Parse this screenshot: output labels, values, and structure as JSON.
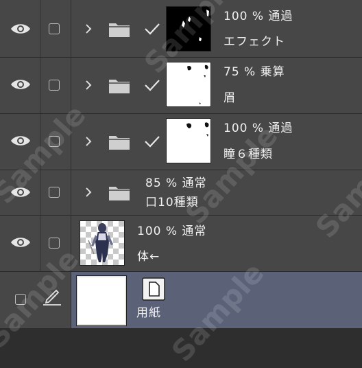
{
  "layers": [
    {
      "opacity": "100 %",
      "blend": "通過",
      "name": "エフェクト"
    },
    {
      "opacity": "75 %",
      "blend": "乗算",
      "name": "眉"
    },
    {
      "opacity": "100 %",
      "blend": "通過",
      "name": "瞳６種類"
    },
    {
      "opacity": "85 %",
      "blend": "通常",
      "name": "口10種類"
    },
    {
      "opacity": "100 %",
      "blend": "通常",
      "name": "体←"
    },
    {
      "name": "用紙"
    }
  ],
  "watermark": "Sample",
  "icons": [
    "eye-icon",
    "checkbox-icon",
    "chevron-right-icon",
    "folder-icon",
    "checkmark-icon",
    "pen-icon",
    "page-icon"
  ]
}
